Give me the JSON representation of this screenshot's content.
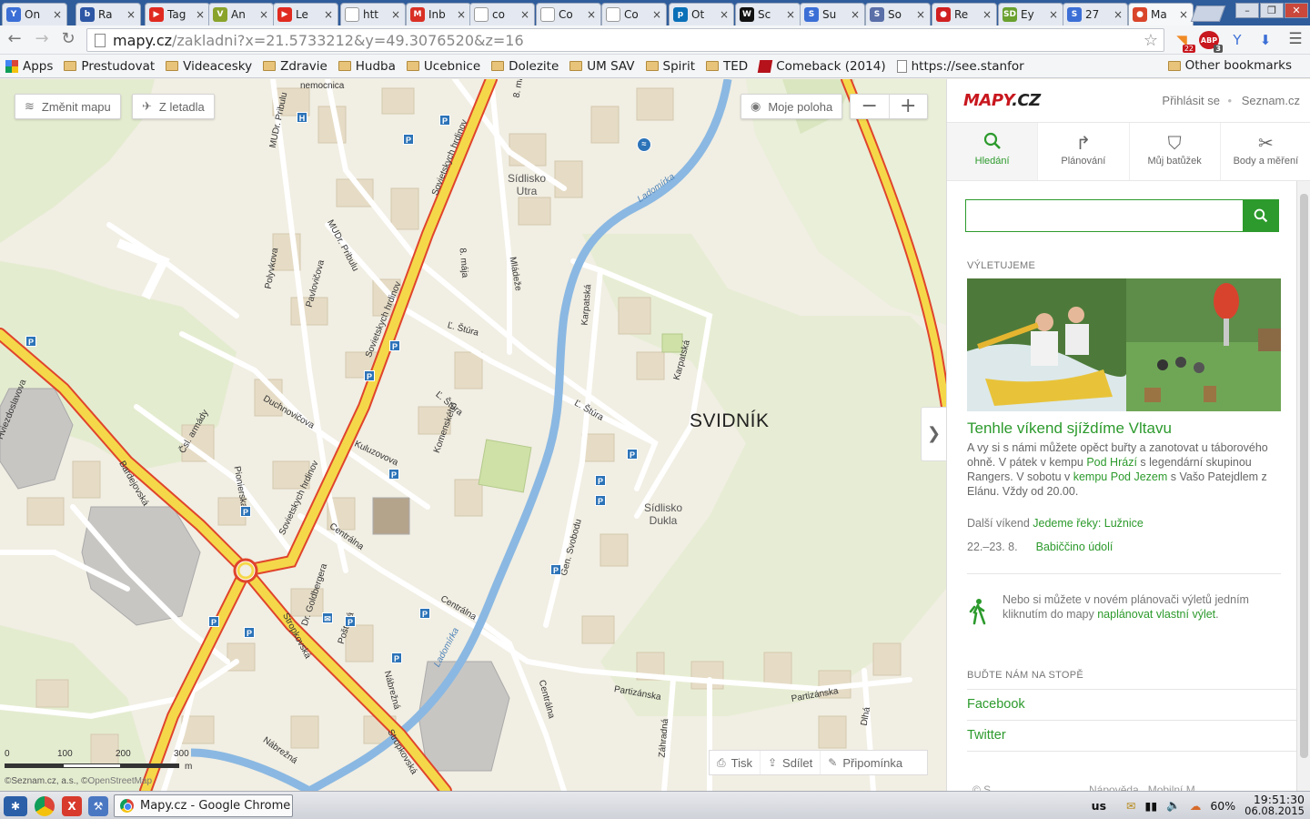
{
  "browser": {
    "tabs": [
      {
        "label": "On",
        "favicon": "y-icon",
        "color": "#3b6fd6",
        "glyph": "Y"
      },
      {
        "label": "Ra",
        "favicon": "bwj-icon",
        "color": "#2d56a5",
        "glyph": "b"
      },
      {
        "label": "Tag",
        "favicon": "youtube-icon",
        "color": "#e02a20",
        "glyph": "▶"
      },
      {
        "label": "An",
        "favicon": "v-icon",
        "color": "#8aa32b",
        "glyph": "V"
      },
      {
        "label": "Le",
        "favicon": "youtube-icon",
        "color": "#e02a20",
        "glyph": "▶"
      },
      {
        "label": "htt",
        "favicon": "page-icon",
        "color": "#ffffff",
        "glyph": ""
      },
      {
        "label": "Inb",
        "favicon": "gmail-icon",
        "color": "#d93025",
        "glyph": "M"
      },
      {
        "label": "co",
        "favicon": "page-icon",
        "color": "#ffffff",
        "glyph": ""
      },
      {
        "label": "Co",
        "favicon": "page-icon",
        "color": "#ffffff",
        "glyph": ""
      },
      {
        "label": "Co",
        "favicon": "page-icon",
        "color": "#ffffff",
        "glyph": ""
      },
      {
        "label": "Ot",
        "favicon": "p-icon",
        "color": "#0a70b8",
        "glyph": "p"
      },
      {
        "label": "Sc",
        "favicon": "w-icon",
        "color": "#111111",
        "glyph": "W"
      },
      {
        "label": "Su",
        "favicon": "s-icon",
        "color": "#3b6fd6",
        "glyph": "S"
      },
      {
        "label": "So",
        "favicon": "lamp-icon",
        "color": "#5a6fa8",
        "glyph": "S"
      },
      {
        "label": "Re",
        "favicon": "pin-icon",
        "color": "#d02020",
        "glyph": "●"
      },
      {
        "label": "Ey",
        "favicon": "sd-icon",
        "color": "#6aa12f",
        "glyph": "SD"
      },
      {
        "label": "27",
        "favicon": "s-icon",
        "color": "#3b6fd6",
        "glyph": "S"
      },
      {
        "label": "Ma",
        "favicon": "mapy-icon",
        "color": "#d9452a",
        "glyph": "●"
      }
    ],
    "window_controls": [
      "–",
      "❐",
      "✕"
    ],
    "url_host": "mapy.cz",
    "url_path": "/zakladni?x=21.5733212&y=49.3076520&z=16",
    "extensions": [
      {
        "name": "rss-icon",
        "badge": "22",
        "color": "#f08a24"
      },
      {
        "name": "adblock-icon",
        "badge": "3",
        "color": "#c8171e"
      },
      {
        "name": "y-icon",
        "badge": "",
        "color": "#3b6fd6"
      },
      {
        "name": "download-icon",
        "badge": "",
        "color": "#3b6fd6"
      }
    ],
    "bookmarks": [
      {
        "label": "Apps",
        "type": "apps"
      },
      {
        "label": "Prestudovat",
        "type": "folder"
      },
      {
        "label": "Videacesky",
        "type": "folder"
      },
      {
        "label": "Zdravie",
        "type": "folder"
      },
      {
        "label": "Hudba",
        "type": "folder"
      },
      {
        "label": "Ucebnice",
        "type": "folder"
      },
      {
        "label": "Dolezite",
        "type": "folder"
      },
      {
        "label": "UM SAV",
        "type": "folder"
      },
      {
        "label": "Spirit",
        "type": "folder"
      },
      {
        "label": "TED",
        "type": "folder"
      },
      {
        "label": "Comeback (2014)",
        "type": "csfd"
      },
      {
        "label": "https://see.stanfor",
        "type": "page"
      }
    ],
    "other_bookmarks": "Other bookmarks"
  },
  "map": {
    "buttons": {
      "change_map": "Změnit mapu",
      "aerial": "Z letadla",
      "my_location": "Moje poloha",
      "zoom_out": "−",
      "zoom_in": "+",
      "collapse": "❯"
    },
    "city": "SVIDNÍK",
    "districts": [
      "Sídlisko\nUtra",
      "Sídlisko\nDukla"
    ],
    "streets": [
      "Sovietskych hrdinov",
      "Sovietskych hrdinov",
      "Sovietskych hrdinov",
      "MUDr. Pribulu",
      "MUDr. Pribulu",
      "8. mája",
      "8. mája",
      "Polyvkova",
      "Pavlovičova",
      "Mládeže",
      "Karpatská",
      "Karpatská",
      "Ľ. Štúra",
      "Ľ. Štúra",
      "Ľ. Štúra",
      "Duchnovičova",
      "Čsl. armády",
      "Bardejovská",
      "Pionierska",
      "Kuluzovova",
      "Komenského",
      "Centrálna",
      "Centrálna",
      "Centrálna",
      "Gen. Svobodu",
      "Dr. Goldbergera",
      "Stropkovská",
      "Stropkovská",
      "Poštová",
      "Nábrežná",
      "Nábrežná",
      "Partizánska",
      "Partizánska",
      "Záhradná",
      "Dlhá",
      "nemocnica",
      "Hviezdoslavova"
    ],
    "rivers": [
      "Ladomírka",
      "Ladomírka"
    ],
    "scale_labels": [
      "0",
      "100",
      "200",
      "300",
      "m"
    ],
    "copyright_a": "©Seznam.cz, a.s.",
    "copyright_b": "©",
    "copyright_c": "OpenStreetMap",
    "bottom_tools": {
      "print": "Tisk",
      "share": "Sdílet",
      "report": "Připomínka"
    }
  },
  "sidebar": {
    "logo_main": "MAPY",
    "logo_suffix": ".CZ",
    "login": "Přihlásit se",
    "separator": "•",
    "seznam": "Seznam.cz",
    "tabs": [
      {
        "label": "Hledání",
        "icon": "search-icon"
      },
      {
        "label": "Plánování",
        "icon": "route-icon"
      },
      {
        "label": "Můj batůžek",
        "icon": "backpack-icon"
      },
      {
        "label": "Body a měření",
        "icon": "measure-icon"
      }
    ],
    "search_value": "",
    "section_trip": "VÝLETUJEME",
    "promo_title": "Tenhle víkend sjíždíme Vltavu",
    "promo_text_1": "A vy si s námi můžete opěct buřty a zanotovat u táborového ohně. V pátek v kempu ",
    "promo_link_1": "Pod Hrází",
    "promo_text_2": " s legendární skupinou Rangers. V sobotu v ",
    "promo_link_2": "kempu Pod Jezem",
    "promo_text_3": " s Vašo Patejdlem z Elánu. Vždy od 20.00.",
    "next_weekend_label": "Další víkend ",
    "next_weekend_link": "Jedeme řeky: Lužnice",
    "date_label": "22.–23. 8.",
    "date_link": "Babiččino údolí",
    "hike_text": "Nebo si můžete v novém plánovači výletů jedním kliknutím do mapy ",
    "hike_link": "naplánovat vlastní výlet",
    "hike_end": ".",
    "section_follow": "BUĎTE NÁM NA STOPĚ",
    "social": [
      "Facebook",
      "Twitter"
    ],
    "footer_partial_a": "© S",
    "footer_partial_b": "Nápověda   Mobilní M"
  },
  "taskbar": {
    "window_title": "Mapy.cz - Google Chrome",
    "kbd": "us",
    "battery": "60%",
    "time": "19:51:30",
    "date": "06.08.2015"
  },
  "colors": {
    "accent_green": "#2c9a2c",
    "road_yellow": "#f5d84a",
    "road_red": "#e0442c",
    "river_blue": "#8ab8e2",
    "brand_red": "#c8171e"
  }
}
